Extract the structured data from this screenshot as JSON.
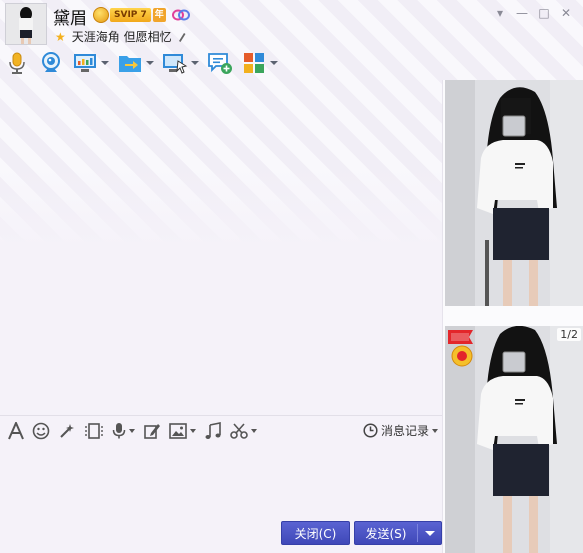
{
  "contact": {
    "nickname": "黛眉",
    "vip_label": "SVIP 7",
    "vip_year": "年",
    "signature": "天涯海角  但愿相忆"
  },
  "window_controls": [
    "▾",
    "—",
    "□",
    "✕"
  ],
  "toolbar_icons": [
    "microphone-icon",
    "video-camera-icon",
    "screen-share-icon",
    "file-transfer-icon",
    "remote-desktop-icon",
    "add-chat-icon",
    "apps-grid-icon"
  ],
  "input_toolbar_icons": [
    "font-icon",
    "emoji-icon",
    "magic-wand-icon",
    "screenshot-frame-icon",
    "voice-message-icon",
    "edit-icon",
    "image-icon",
    "music-icon",
    "scissors-icon"
  ],
  "history": {
    "label": "消息记录"
  },
  "side": {
    "pager": "1/2"
  },
  "buttons": {
    "close": "关闭(C)",
    "send": "发送(S)"
  },
  "colors": {
    "accent": "#4a53c4",
    "vip_gold": "#f2a81b",
    "icon_blue": "#2f8ad8"
  }
}
